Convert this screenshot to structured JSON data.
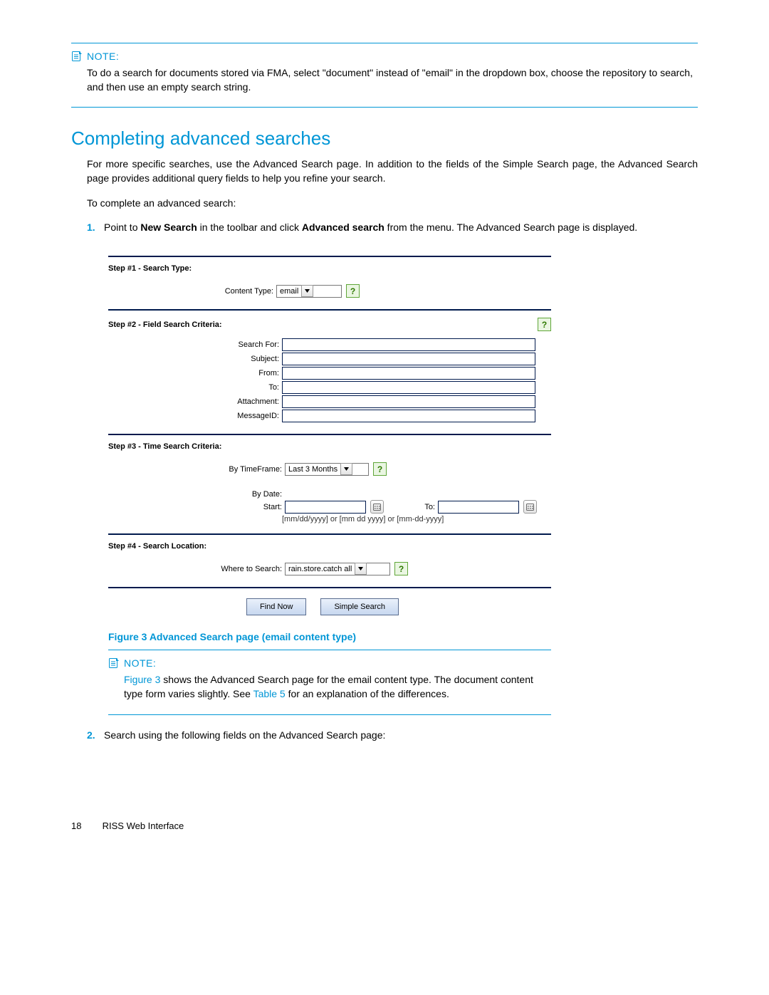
{
  "note1": {
    "label": "NOTE:",
    "body": "To do a search for documents stored via FMA, select \"document\" instead of \"email\" in the dropdown box, choose the repository to search, and then use an empty search string."
  },
  "section_heading": "Completing advanced searches",
  "intro": "For more specific searches, use the Advanced Search page. In addition to the fields of the Simple Search page, the Advanced Search page provides additional query fields to help you refine your search.",
  "lead": "To complete an advanced search:",
  "step1": {
    "marker": "1.",
    "pre": "Point to ",
    "b1": "New Search",
    "mid": " in the toolbar and click ",
    "b2": "Advanced search",
    "post": " from the menu. The Advanced Search page is displayed."
  },
  "step2": {
    "marker": "2.",
    "text": "Search using the following fields on the Advanced Search page:"
  },
  "figure": {
    "s1": {
      "title": "Step #1 - Search Type:",
      "label": "Content Type:",
      "value": "email"
    },
    "s2": {
      "title": "Step #2 - Field Search Criteria:",
      "f_searchfor": "Search For:",
      "f_subject": "Subject:",
      "f_from": "From:",
      "f_to": "To:",
      "f_attachment": "Attachment:",
      "f_messageid": "MessageID:"
    },
    "s3": {
      "title": "Step #3 - Time Search Criteria:",
      "tf_label": "By TimeFrame:",
      "tf_value": "Last 3 Months",
      "bydate": "By Date:",
      "start": "Start:",
      "to": "To:",
      "hint": "[mm/dd/yyyy] or [mm dd yyyy] or [mm-dd-yyyy]"
    },
    "s4": {
      "title": "Step #4 - Search Location:",
      "label": "Where to Search:",
      "value": "rain.store.catch all"
    },
    "btn_find": "Find Now",
    "btn_simple": "Simple Search"
  },
  "caption": "Figure 3 Advanced Search page (email content type)",
  "note2": {
    "label": "NOTE:",
    "link1": "Figure 3",
    "mid": " shows the Advanced Search page for the email content type. The document content type form varies slightly. See ",
    "link2": "Table 5",
    "post": " for an explanation of the differences."
  },
  "footer": {
    "page": "18",
    "title": "RISS Web Interface"
  }
}
